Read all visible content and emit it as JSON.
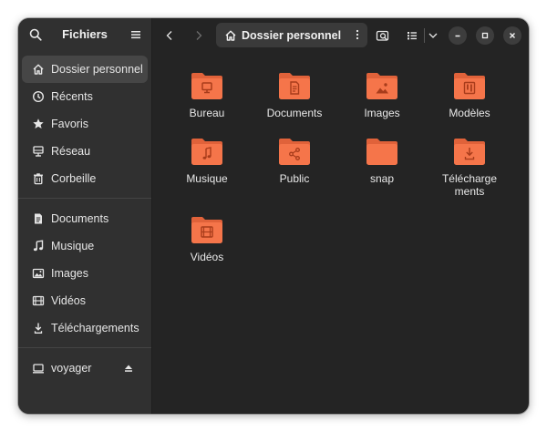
{
  "app": {
    "title": "Fichiers"
  },
  "sidebar": {
    "places": [
      {
        "label": "Dossier personnel",
        "icon": "home-icon",
        "active": true
      },
      {
        "label": "Récents",
        "icon": "clock-icon"
      },
      {
        "label": "Favoris",
        "icon": "star-icon"
      },
      {
        "label": "Réseau",
        "icon": "network-icon"
      },
      {
        "label": "Corbeille",
        "icon": "trash-icon"
      }
    ],
    "bookmarks": [
      {
        "label": "Documents",
        "icon": "document-icon"
      },
      {
        "label": "Musique",
        "icon": "music-icon"
      },
      {
        "label": "Images",
        "icon": "image-icon"
      },
      {
        "label": "Vidéos",
        "icon": "video-icon"
      },
      {
        "label": "Téléchargements",
        "icon": "download-icon"
      }
    ],
    "devices": [
      {
        "label": "voyager",
        "icon": "drive-icon",
        "action_icon": "eject-icon"
      }
    ]
  },
  "toolbar": {
    "path": "Dossier personnel"
  },
  "colors": {
    "window_bg": "#242424",
    "sidebar_bg": "#303030",
    "folder_body": "#F5754A",
    "folder_tab": "#E0623A",
    "folder_glyph": "#A83C1B"
  },
  "files": [
    {
      "name_lines": [
        "Bureau"
      ],
      "emblem": "desktop-emblem"
    },
    {
      "name_lines": [
        "Documents"
      ],
      "emblem": "document-emblem"
    },
    {
      "name_lines": [
        "Images"
      ],
      "emblem": "image-emblem"
    },
    {
      "name_lines": [
        "Modèles"
      ],
      "emblem": "template-emblem"
    },
    {
      "name_lines": [
        "Musique"
      ],
      "emblem": "music-emblem"
    },
    {
      "name_lines": [
        "Public"
      ],
      "emblem": "share-emblem"
    },
    {
      "name_lines": [
        "snap"
      ],
      "emblem": "none"
    },
    {
      "name_lines": [
        "Télécharge",
        "ments"
      ],
      "emblem": "download-emblem"
    },
    {
      "name_lines": [
        "Vidéos"
      ],
      "emblem": "video-emblem"
    }
  ]
}
